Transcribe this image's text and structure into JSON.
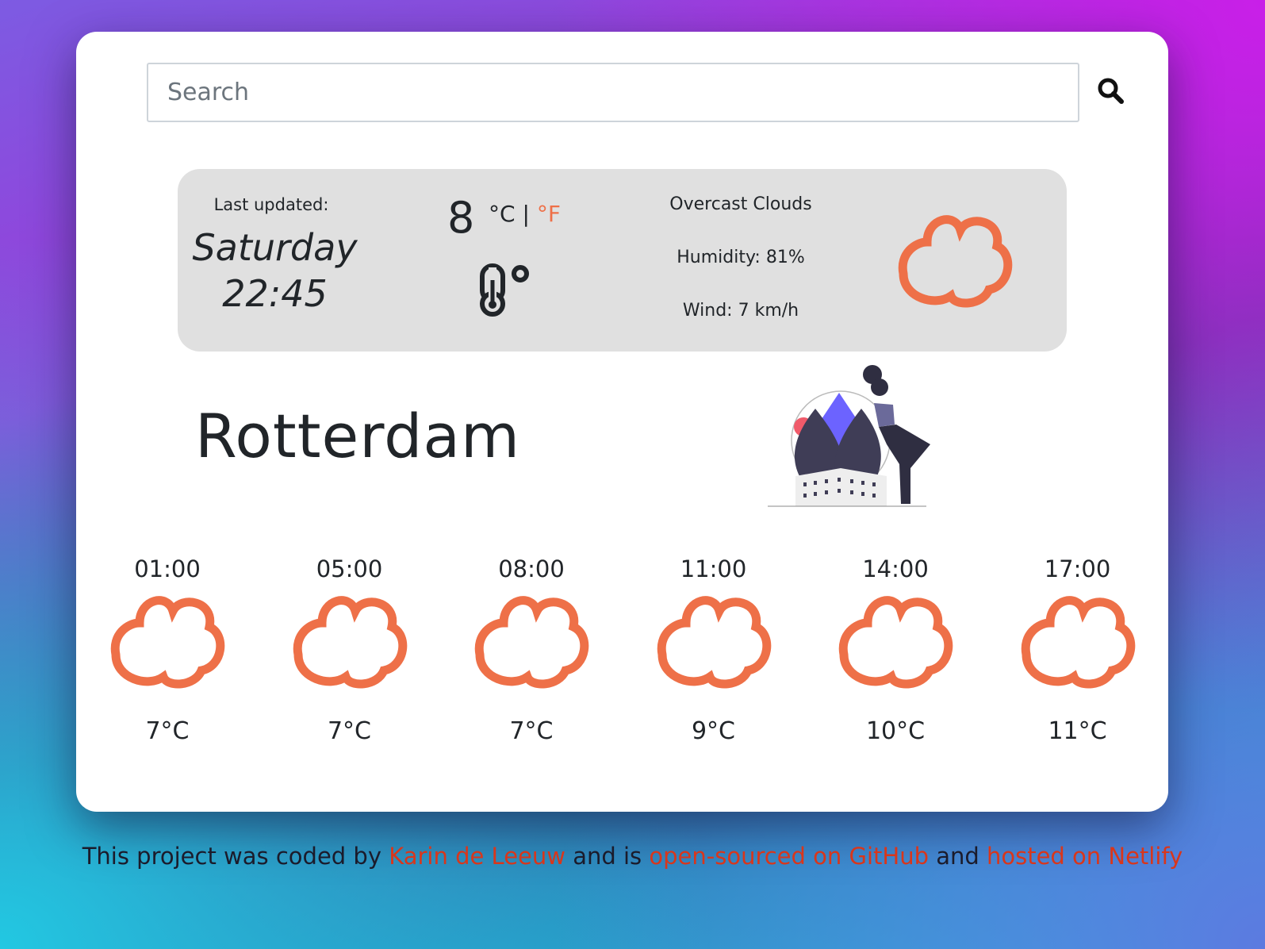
{
  "search": {
    "placeholder": "Search",
    "icon": "search-icon"
  },
  "current": {
    "last_updated_label": "Last updated:",
    "day": "Saturday",
    "time": "22:45",
    "temperature": "8",
    "unit_c": "°C",
    "separator": "|",
    "unit_f": "°F",
    "description": "Overcast Clouds",
    "humidity": "Humidity: 81%",
    "wind": "Wind: 7 km/h",
    "icon": "cloud-icon"
  },
  "city": "Rotterdam",
  "forecast": [
    {
      "time": "01:00",
      "temp": "7°C"
    },
    {
      "time": "05:00",
      "temp": "7°C"
    },
    {
      "time": "08:00",
      "temp": "7°C"
    },
    {
      "time": "11:00",
      "temp": "9°C"
    },
    {
      "time": "14:00",
      "temp": "10°C"
    },
    {
      "time": "17:00",
      "temp": "11°C"
    }
  ],
  "footer": {
    "t1": "This project was coded by ",
    "l1": "Karin de Leeuw",
    "t2": " and is ",
    "l2": "open-sourced on GitHub",
    "t3": " and ",
    "l3": "hosted on Netlify"
  },
  "colors": {
    "accent": "#ee7048",
    "panel": "#e0e0e0",
    "link": "#d9361b"
  }
}
